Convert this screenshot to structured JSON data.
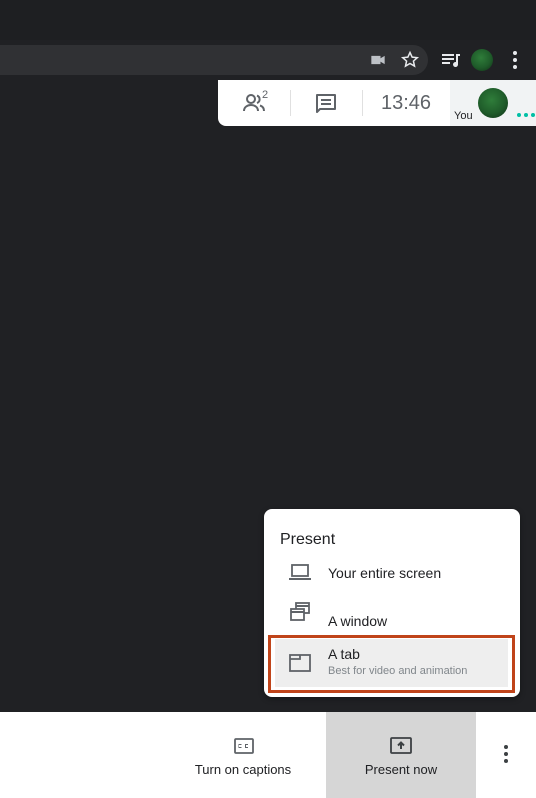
{
  "meet_bar": {
    "participant_count": "2",
    "clock": "13:46",
    "self_label": "You"
  },
  "present_menu": {
    "title": "Present",
    "items": [
      {
        "label": "Your entire screen",
        "icon": "laptop-icon"
      },
      {
        "label": "A window",
        "icon": "window-icon"
      },
      {
        "label": "A tab",
        "sublabel": "Best for video and animation",
        "icon": "tab-icon"
      }
    ]
  },
  "bottom_bar": {
    "captions_label": "Turn on captions",
    "present_label": "Present now"
  },
  "colors": {
    "background": "#202124",
    "highlight_border": "#c0441a",
    "present_button_bg": "#d6d6d6",
    "accent_dots": "#00bfa5"
  }
}
